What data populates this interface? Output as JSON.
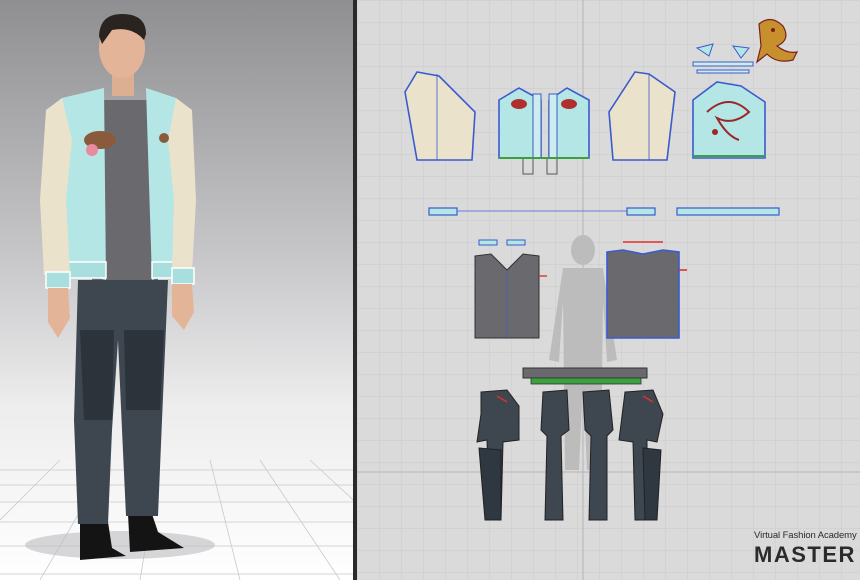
{
  "app": {
    "panels": [
      "3d-view",
      "2d-pattern-window"
    ]
  },
  "watermark": {
    "line1": "Virtual Fashion Academy",
    "line2": "MASTER"
  },
  "colors": {
    "jacket": "#b4e6e6",
    "sleeve": "#ebe2cc",
    "vest": "#6a6a6e",
    "pants": "#3e4650",
    "grid_2d": "#dadada",
    "pattern_outline": "#3a5bd0",
    "seam_red": "#e03030",
    "seam_green": "#3aa040"
  },
  "icons": [
    "tiger-embroidery-icon",
    "dragon-embroidery-icon"
  ]
}
